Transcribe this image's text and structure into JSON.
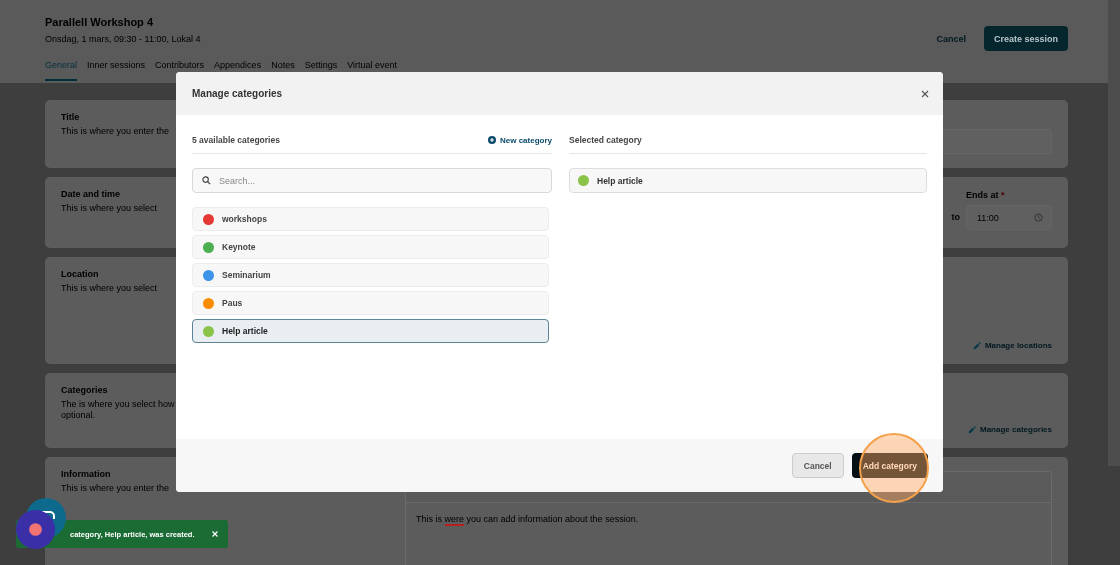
{
  "page": {
    "title": "Parallell Workshop 4",
    "subtitle": "Onsdag, 1 mars, 09:30 - 11:00, Lokal 4",
    "cancel": "Cancel",
    "primary": "Create session",
    "tabs": [
      {
        "label": "General",
        "selected": true
      },
      {
        "label": "Inner sessions",
        "selected": false
      },
      {
        "label": "Contributors",
        "selected": false
      },
      {
        "label": "Appendices",
        "selected": false
      },
      {
        "label": "Notes",
        "selected": false
      },
      {
        "label": "Settings",
        "selected": false
      },
      {
        "label": "Virtual event",
        "selected": false
      }
    ],
    "sections": [
      {
        "kind": "input",
        "title": "Title",
        "description": [
          "This is where you enter the"
        ]
      },
      {
        "kind": "time",
        "title": "Date and time",
        "description": [
          "This is where you select"
        ],
        "to": "to",
        "end_label": "Ends at",
        "required_mark": "*",
        "end_value": "11:00"
      },
      {
        "kind": "link",
        "title": "Location",
        "description": [
          "This is where you select"
        ],
        "link": "Manage locations"
      },
      {
        "kind": "link",
        "title": "Categories",
        "description": [
          "The is where you select how",
          "optional."
        ],
        "link": "Manage categories"
      },
      {
        "kind": "editor",
        "title": "Information",
        "description": [
          "This is where you enter the"
        ],
        "content": [
          {
            "text": "This is ",
            "misspelled": false
          },
          {
            "text": "were",
            "misspelled": true
          },
          {
            "text": " you can add information about the session.",
            "misspelled": false
          }
        ]
      }
    ]
  },
  "modal": {
    "title": "Manage categories",
    "count_label": "5 available categories",
    "new_button": "New category",
    "search_placeholder": "Search...",
    "categories": [
      {
        "name": "workshops",
        "color": "#e53935",
        "selected": false
      },
      {
        "name": "Keynote",
        "color": "#4caf50",
        "selected": false
      },
      {
        "name": "Seminarium",
        "color": "#3d94e8",
        "selected": false
      },
      {
        "name": "Paus",
        "color": "#fb8c00",
        "selected": false
      },
      {
        "name": "Help article",
        "color": "#8bc34a",
        "selected": true
      }
    ],
    "selected_heading": "Selected category",
    "selected": [
      {
        "name": "Help article",
        "color": "#8bc34a"
      }
    ],
    "cancel": "Cancel",
    "confirm": "Add category"
  },
  "toast": {
    "message": "category, Help article, was created."
  }
}
